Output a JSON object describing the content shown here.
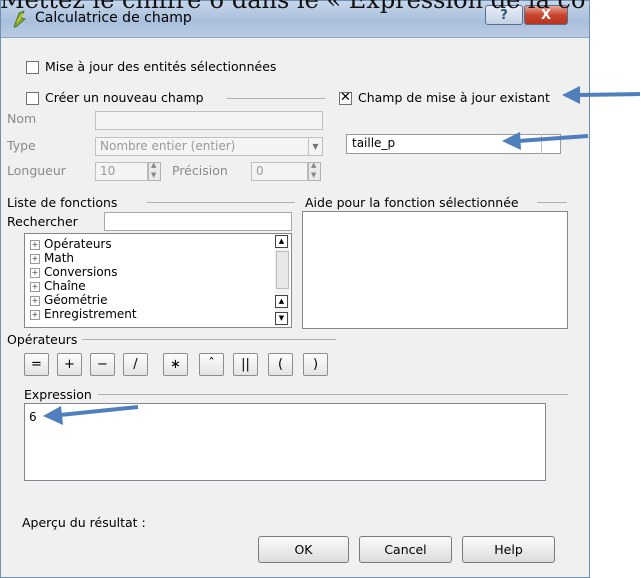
{
  "caption": "Mettez le chiffre 6 dans le « Expression de la co",
  "window": {
    "title": "Calculatrice de champ",
    "help_glyph": "?",
    "close_glyph": "X"
  },
  "options": {
    "update_selected_label": "Mise à jour des entités sélectionnées",
    "update_selected_checked": false,
    "create_field_label": "Créer un nouveau champ",
    "create_field_checked": false,
    "update_existing_label": "Champ de mise à jour existant",
    "update_existing_checked": true
  },
  "new_field": {
    "name_label": "Nom",
    "name_value": "",
    "type_label": "Type",
    "type_value": "Nombre entier (entier)",
    "length_label": "Longueur",
    "length_value": "10",
    "precision_label": "Précision",
    "precision_value": "0"
  },
  "existing_field": {
    "selected": "taille_p"
  },
  "functions": {
    "group_label": "Liste de fonctions",
    "search_label": "Rechercher",
    "search_value": "",
    "items": [
      "Opérateurs",
      "Math",
      "Conversions",
      "Chaîne",
      "Géométrie",
      "Enregistrement"
    ]
  },
  "help_panel": {
    "label": "Aide pour la fonction sélectionnée"
  },
  "operators": {
    "label": "Opérateurs",
    "buttons": [
      "=",
      "+",
      "−",
      "/",
      "∗",
      "ˆ",
      "||",
      "(",
      ")"
    ]
  },
  "expression": {
    "label": "Expression",
    "value": "6"
  },
  "preview": {
    "label": "Aperçu du résultat :"
  },
  "buttons": {
    "ok": "OK",
    "cancel": "Cancel",
    "help": "Help"
  },
  "colors": {
    "annotation_arrow": "#4f7fbd",
    "titlebar": "#b9cbe4",
    "close_button": "#c9442c"
  }
}
